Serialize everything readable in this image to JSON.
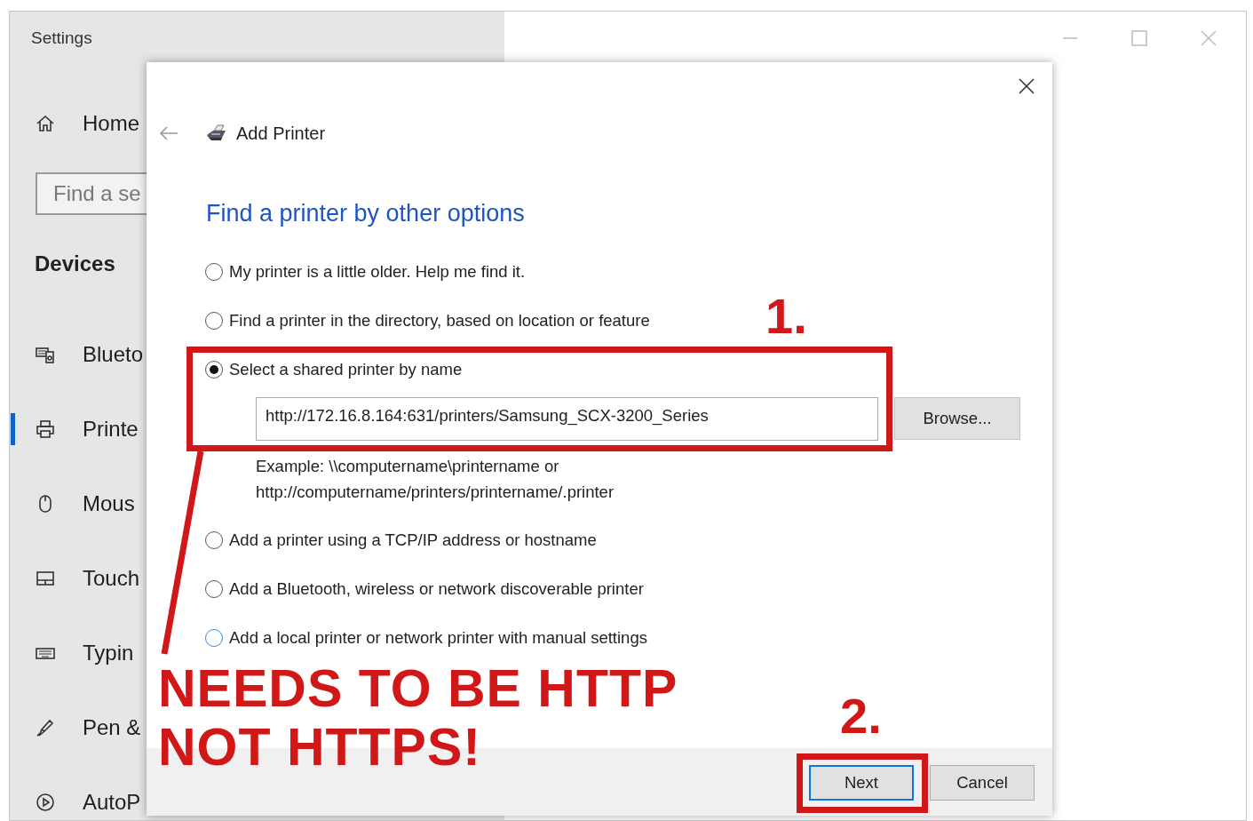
{
  "window": {
    "title": "Settings",
    "controls": [
      {
        "kind": "minimize"
      },
      {
        "kind": "maximize"
      },
      {
        "kind": "close"
      }
    ]
  },
  "sidebar": {
    "home": {
      "label": "Home",
      "kind": "home"
    },
    "search": {
      "placeholder": "Find a se"
    },
    "heading": "Devices",
    "items": [
      {
        "label": "Blueto",
        "kind": "devices",
        "selected": false
      },
      {
        "label": "Printe",
        "kind": "printer",
        "selected": true
      },
      {
        "label": "Mous",
        "kind": "mouse",
        "selected": false
      },
      {
        "label": "Touch",
        "kind": "touchpad",
        "selected": false
      },
      {
        "label": "Typin",
        "kind": "keyboard",
        "selected": false
      },
      {
        "label": "Pen &",
        "kind": "pen",
        "selected": false
      },
      {
        "label": "AutoP",
        "kind": "autoplay",
        "selected": false
      }
    ]
  },
  "dialog": {
    "title": "Add Printer",
    "heading": "Find a printer by other options",
    "options": [
      {
        "label": "My printer is a little older. Help me find it.",
        "selected": false,
        "focused": false
      },
      {
        "label": "Find a printer in the directory, based on location or feature",
        "selected": false,
        "focused": false
      },
      {
        "label": "Select a shared printer by name",
        "selected": true,
        "focused": false,
        "field": {
          "value": "http://172.16.8.164:631/printers/Samsung_SCX-3200_Series"
        },
        "browse": "Browse...",
        "example": [
          "Example: \\\\computername\\printername or",
          "http://computername/printers/printername/.printer"
        ]
      },
      {
        "label": "Add a printer using a TCP/IP address or hostname",
        "selected": false,
        "focused": false
      },
      {
        "label": "Add a Bluetooth, wireless or network discoverable printer",
        "selected": false,
        "focused": false
      },
      {
        "label": "Add a local printer or network printer with manual settings",
        "selected": false,
        "focused": true
      }
    ],
    "buttons": [
      {
        "label": "Next",
        "default": true
      },
      {
        "label": "Cancel",
        "default": false
      }
    ]
  },
  "annotations": [
    {
      "kind": "number",
      "text": "1."
    },
    {
      "kind": "note",
      "lines": [
        "NEEDS TO BE HTTP",
        "NOT HTTPS!"
      ]
    },
    {
      "kind": "number",
      "text": "2."
    }
  ]
}
